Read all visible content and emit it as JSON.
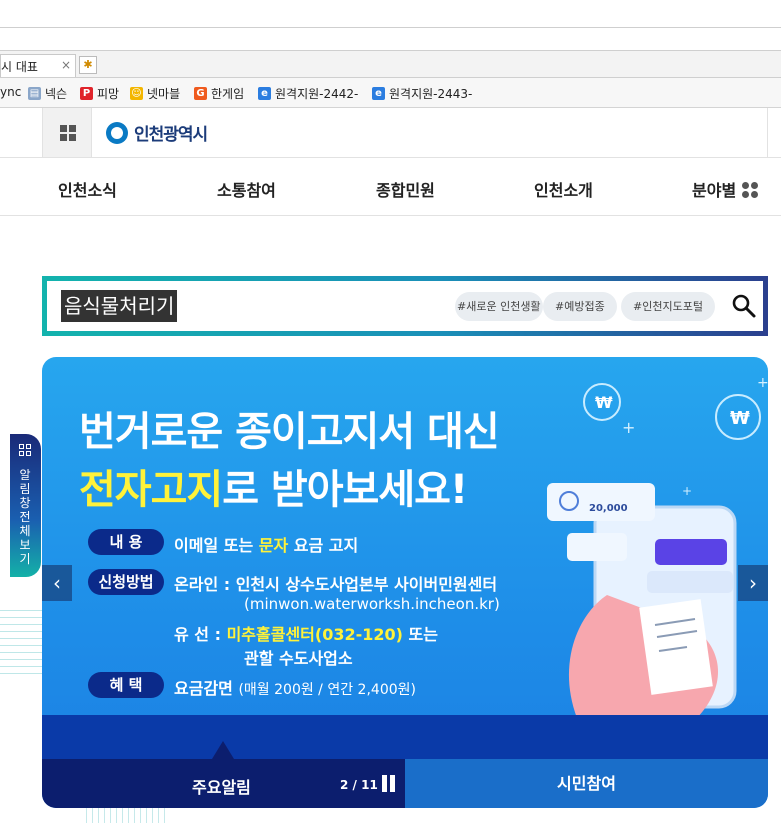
{
  "browser": {
    "tab_title": "시 대표",
    "tab_close": "×",
    "bookmarks": [
      {
        "label": "ync",
        "icon": "",
        "color": ""
      },
      {
        "label": "넥슨",
        "icon": "page-icon",
        "color": "#8aa6c9"
      },
      {
        "label": "피망",
        "icon": "pmang-icon",
        "color": "#e0242b"
      },
      {
        "label": "넷마블",
        "icon": "netmarble-icon",
        "color": "#f3b600"
      },
      {
        "label": "한게임",
        "icon": "hangame-icon",
        "color": "#ef5a1e"
      },
      {
        "label": "원격지원-2442-",
        "icon": "ie-icon",
        "color": "#2b7de0"
      },
      {
        "label": "원격지원-2443-",
        "icon": "ie-icon",
        "color": "#2b7de0"
      }
    ]
  },
  "header": {
    "logo_text": "인천광역시"
  },
  "nav": {
    "items": [
      "인천소식",
      "소통참여",
      "종합민원",
      "인천소개",
      "분야별"
    ]
  },
  "search": {
    "value": "음식물처리기",
    "chips": [
      "#새로운 인천생활",
      "#예방접종",
      "#인천지도포털"
    ]
  },
  "banner": {
    "title_line1": "번거로운 종이고지서 대신",
    "title_line2_highlight": "전자고지",
    "title_line2_rest": "로 받아보세요!",
    "rows": [
      {
        "label": "내    용",
        "text_pre": "이메일 또는 ",
        "text_hl": "문자",
        "text_post": " 요금 고지"
      },
      {
        "label": "신청방법",
        "text": "온라인 : 인천시 상수도사업본부 사이버민원센터"
      },
      {
        "label": "",
        "text": "(minwon.waterworksh.incheon.kr)"
      },
      {
        "label": "",
        "text_pre": "유    선 : ",
        "text_hl": "미추홀콜센터(032-120)",
        "text_post": " 또는"
      },
      {
        "label": "",
        "text_hl": "관할 수도사업소"
      },
      {
        "label": "혜    택",
        "text_pre": "요금감면 ",
        "text_small": "(매월 200원 / 연간 2,400원)"
      }
    ],
    "receipt_amount": "20,000",
    "won_symbol": "₩"
  },
  "tabs": {
    "main_label": "주요알림",
    "pager": "2 / 11",
    "citizen_label": "시민참여"
  },
  "side_tab": {
    "label": "알림창전체보기"
  },
  "colors": {
    "banner_bg": "#1e8de8",
    "navy": "#0c1e6e",
    "highlight": "#fff23a"
  }
}
